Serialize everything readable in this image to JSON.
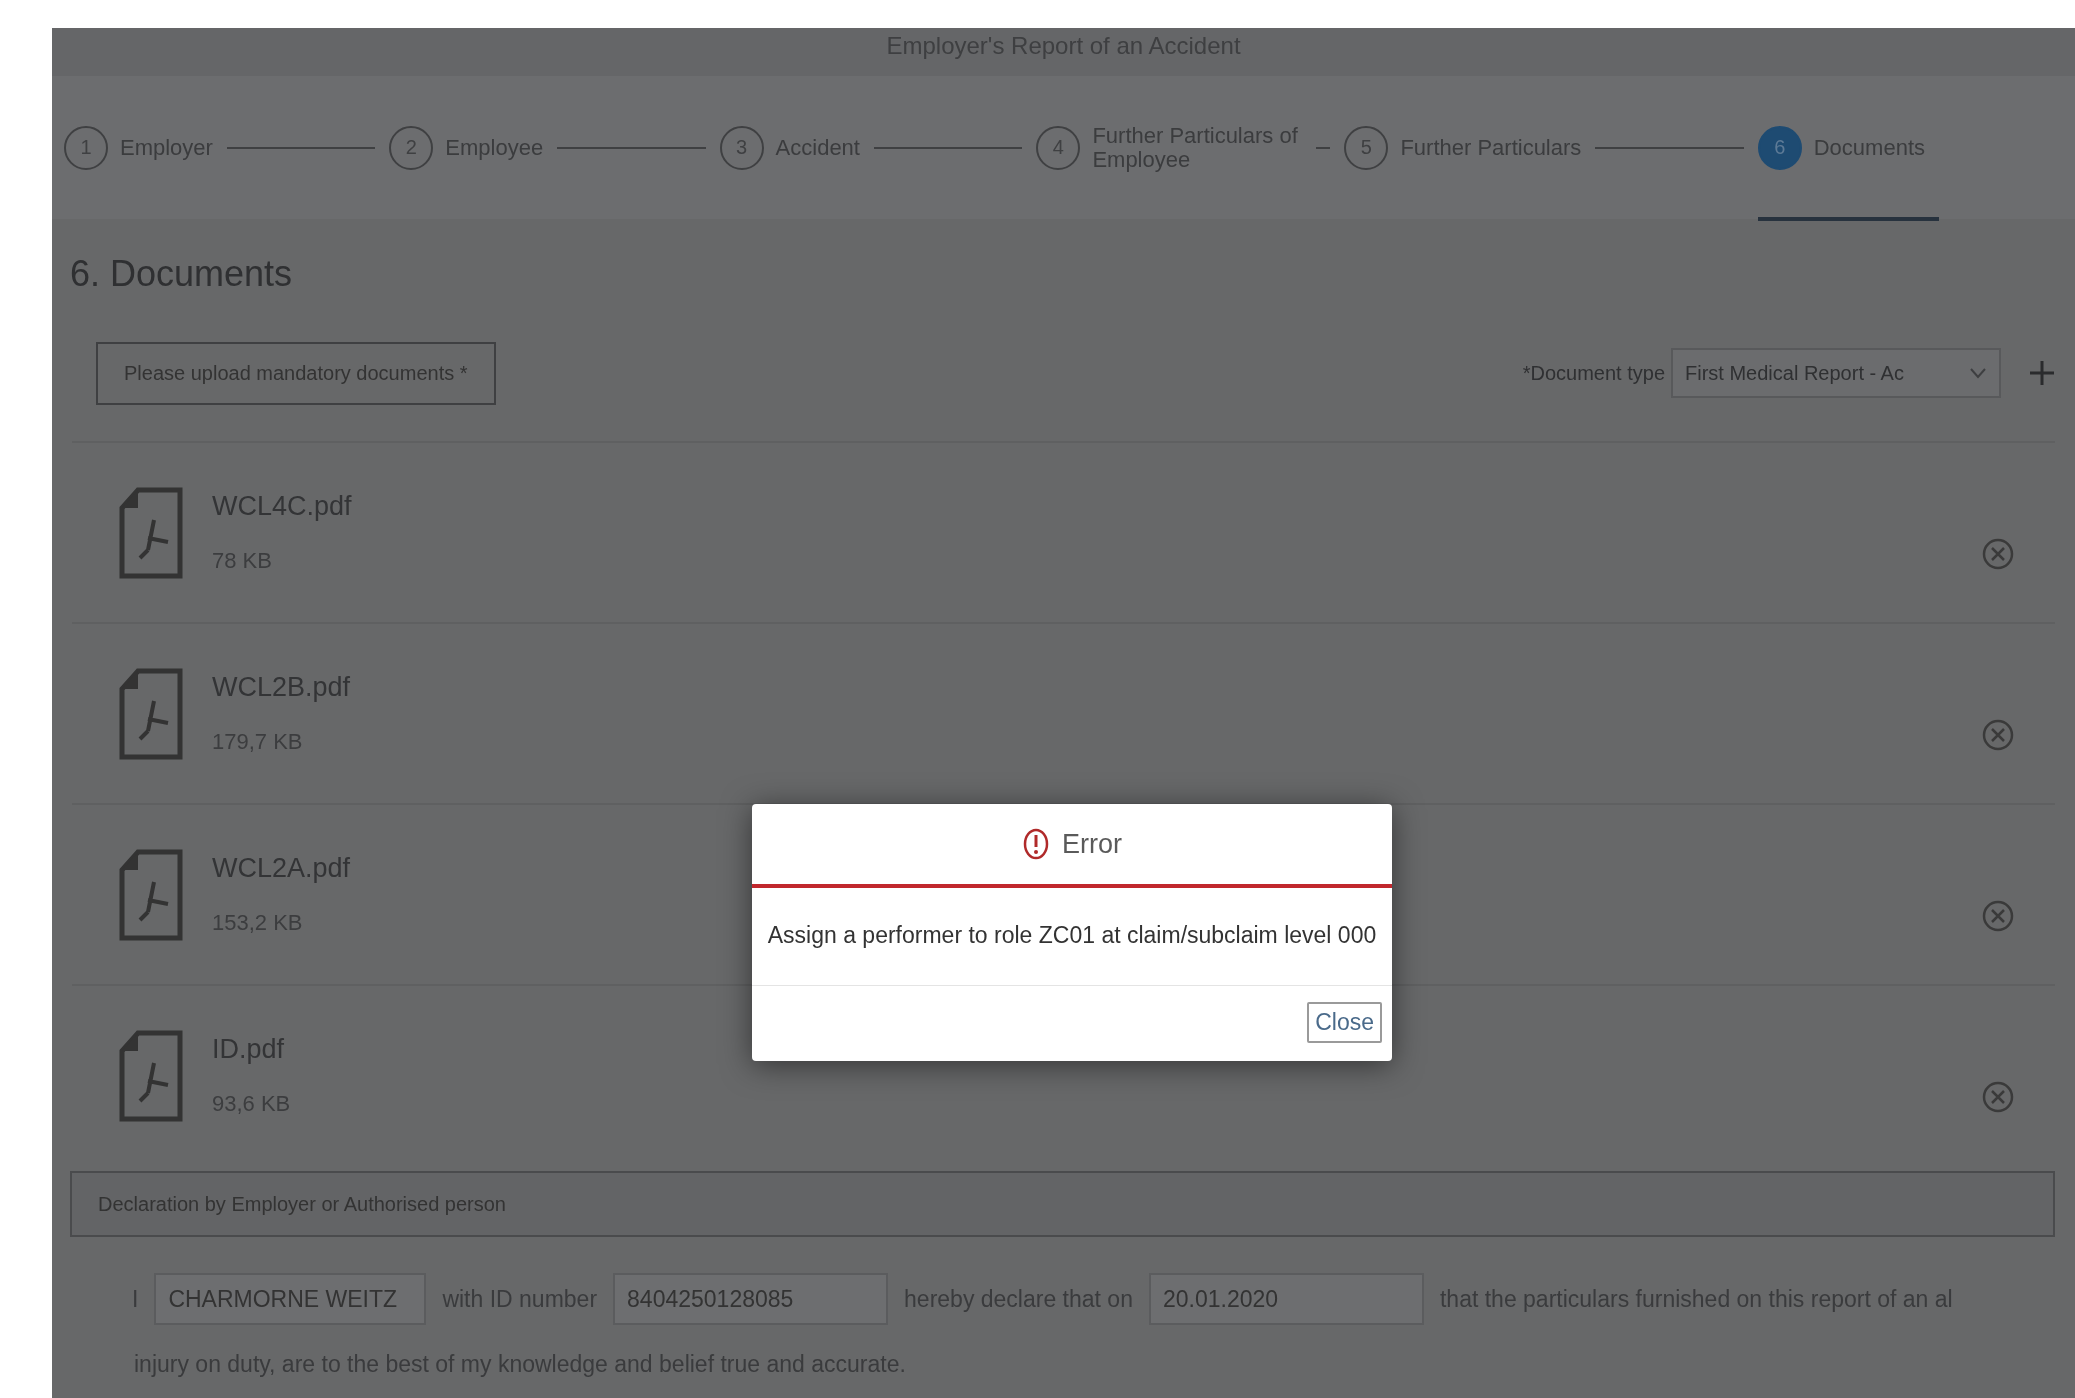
{
  "header": {
    "title": "Employer's Report of an Accident"
  },
  "steps": [
    {
      "number": "1",
      "label": "Employer",
      "selected": false
    },
    {
      "number": "2",
      "label": "Employee",
      "selected": false
    },
    {
      "number": "3",
      "label": "Accident",
      "selected": false
    },
    {
      "number": "4",
      "label": "Further Particulars of Employee",
      "selected": false
    },
    {
      "number": "5",
      "label": "Further Particulars",
      "selected": false
    },
    {
      "number": "6",
      "label": "Documents",
      "selected": true
    }
  ],
  "section_title": "6. Documents",
  "toolbar": {
    "message": "Please upload mandatory documents *",
    "document_type_label": "*Document type",
    "document_type_value": "First Medical Report - Ac"
  },
  "documents": [
    {
      "name": "WCL4C.pdf",
      "size": "78 KB"
    },
    {
      "name": "WCL2B.pdf",
      "size": "179,7 KB"
    },
    {
      "name": "WCL2A.pdf",
      "size": "153,2 KB"
    },
    {
      "name": "ID.pdf",
      "size": "93,6 KB"
    }
  ],
  "declaration": {
    "heading": "Declaration by Employer or Authorised person",
    "prefix": "I",
    "name": "CHARMORNE WEITZ",
    "id_label": "with ID number",
    "id_number": "8404250128085",
    "date_label": "hereby declare that on",
    "date": "20.01.2020",
    "suffix": "that the particulars furnished on this report of an al",
    "line_2": "injury on duty, are to the best of my knowledge and belief true and accurate."
  },
  "dialog": {
    "title": "Error",
    "message": "Assign a performer to role ZC01 at claim/subclaim level 000",
    "button": "Close"
  }
}
